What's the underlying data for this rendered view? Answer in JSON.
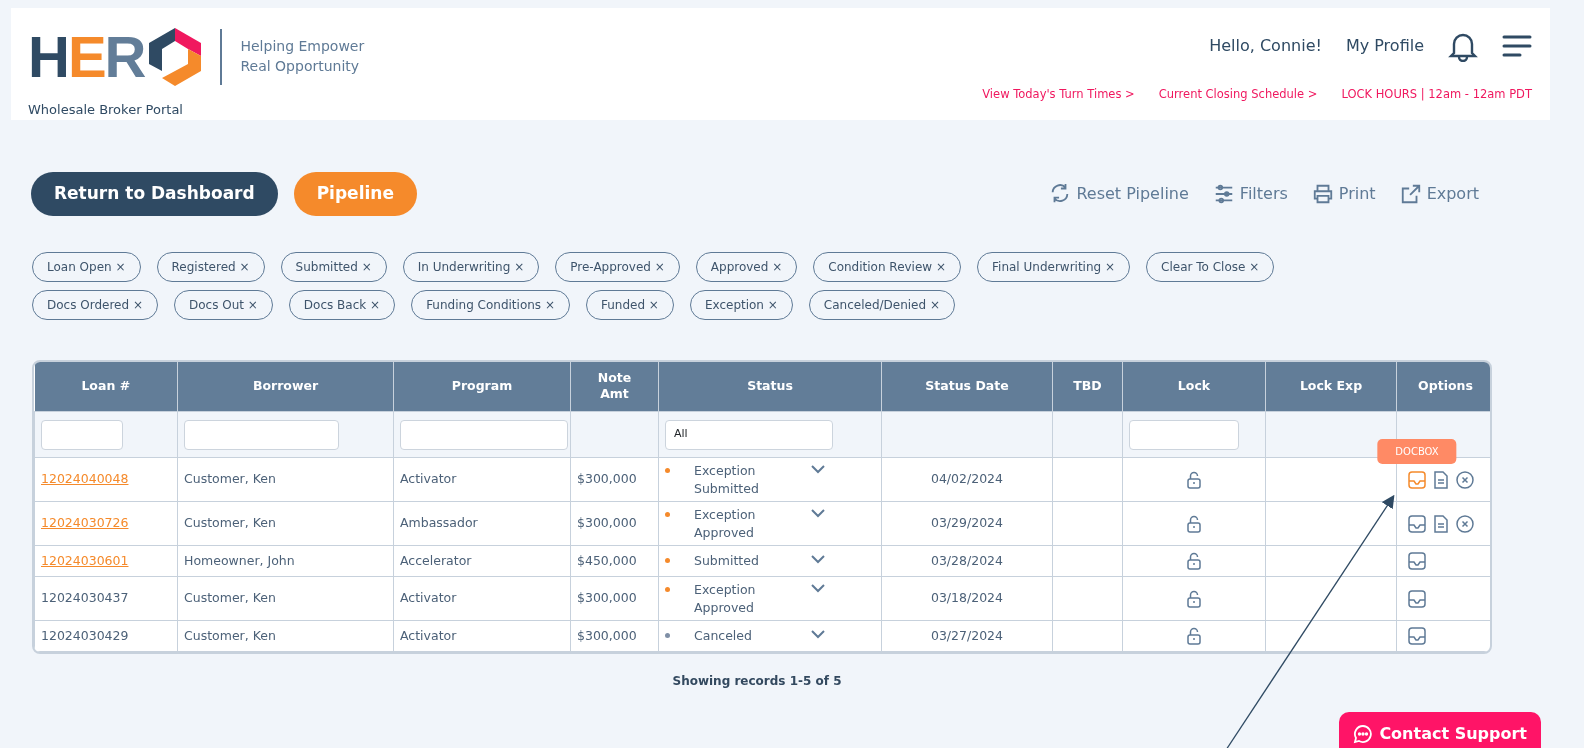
{
  "header": {
    "logo": {
      "letters": [
        "H",
        "E",
        "R"
      ]
    },
    "tagline": [
      "Helping Empower",
      "Real Opportunity"
    ],
    "portal_name": "Wholesale Broker Portal",
    "greeting": "Hello, Connie!",
    "profile_link": "My Profile",
    "links": [
      "View Today's Turn Times >",
      "Current Closing Schedule >",
      "LOCK HOURS | 12am - 12am PDT"
    ]
  },
  "actions": {
    "primary": [
      {
        "label": "Return to Dashboard",
        "kind": "dark"
      },
      {
        "label": "Pipeline",
        "kind": "orange"
      }
    ],
    "tools": [
      {
        "label": "Reset Pipeline",
        "kind": "reset"
      },
      {
        "label": "Filters",
        "kind": "filters"
      },
      {
        "label": "Print",
        "kind": "print"
      },
      {
        "label": "Export",
        "kind": "export"
      }
    ]
  },
  "filter_chips": [
    [
      {
        "label": "Loan Open",
        "remove": "×"
      },
      {
        "label": "Registered",
        "remove": "×"
      },
      {
        "label": "Submitted",
        "remove": "×"
      },
      {
        "label": "In Underwriting",
        "remove": "×"
      },
      {
        "label": "Pre-Approved",
        "remove": "×"
      },
      {
        "label": "Approved",
        "remove": "×"
      },
      {
        "label": "Condition Review",
        "remove": "×"
      },
      {
        "label": "Final Underwriting",
        "remove": "×"
      },
      {
        "label": "Clear To Close",
        "remove": "×"
      }
    ],
    [
      {
        "label": "Docs Ordered",
        "remove": "×"
      },
      {
        "label": "Docs Out",
        "remove": "×"
      },
      {
        "label": "Docs Back",
        "remove": "×"
      },
      {
        "label": "Funding Conditions",
        "remove": "×"
      },
      {
        "label": "Funded",
        "remove": "×"
      },
      {
        "label": "Exception",
        "remove": "×"
      },
      {
        "label": "Canceled/Denied",
        "remove": "×"
      }
    ]
  ],
  "table": {
    "columns": [
      {
        "label": "Loan #",
        "kind": "text"
      },
      {
        "label": "Borrower",
        "kind": "text"
      },
      {
        "label": "Program",
        "kind": "select"
      },
      {
        "label": "Note Amt",
        "kind": "none"
      },
      {
        "label": "Status",
        "kind": "select",
        "value": "All"
      },
      {
        "label": "Status Date",
        "kind": "none"
      },
      {
        "label": "TBD",
        "kind": "none"
      },
      {
        "label": "Lock",
        "kind": "select"
      },
      {
        "label": "Lock Exp",
        "kind": "none"
      },
      {
        "label": "Options",
        "kind": "none"
      }
    ],
    "rows": [
      {
        "loan": "12024040048",
        "linked": true,
        "borrower": "Customer, Ken",
        "program": "Activator",
        "note_amt": "$300,000",
        "status": "Exception Submitted",
        "color": "#f58a2b",
        "status_date": "04/02/2024",
        "options": [
          {
            "kind": "docbox",
            "highlighted": true,
            "tooltip": "DOCBOX"
          },
          {
            "kind": "document",
            "highlighted": false
          },
          {
            "kind": "cancel",
            "highlighted": false
          }
        ]
      },
      {
        "loan": "12024030726",
        "linked": true,
        "borrower": "Customer, Ken",
        "program": "Ambassador",
        "note_amt": "$300,000",
        "status": "Exception Approved",
        "color": "#f58a2b",
        "status_date": "03/29/2024",
        "options": [
          {
            "kind": "docbox",
            "highlighted": false
          },
          {
            "kind": "document",
            "highlighted": false
          },
          {
            "kind": "cancel",
            "highlighted": false
          }
        ]
      },
      {
        "loan": "12024030601",
        "linked": true,
        "borrower": "Homeowner, John",
        "program": "Accelerator",
        "note_amt": "$450,000",
        "status": "Submitted",
        "color": "#f58a2b",
        "status_date": "03/28/2024",
        "options": [
          {
            "kind": "docbox",
            "highlighted": false
          }
        ]
      },
      {
        "loan": "12024030437",
        "linked": false,
        "borrower": "Customer, Ken",
        "program": "Activator",
        "note_amt": "$300,000",
        "status": "Exception Approved",
        "status_date": "03/18/2024",
        "color": "#f58a2b",
        "options": [
          {
            "kind": "docbox",
            "highlighted": false
          }
        ]
      },
      {
        "loan": "12024030429",
        "linked": false,
        "borrower": "Customer, Ken",
        "program": "Activator",
        "note_amt": "$300,000",
        "status": "Canceled",
        "color": "#7f8fa6",
        "status_date": "03/27/2024",
        "options": [
          {
            "kind": "docbox",
            "highlighted": false
          }
        ]
      }
    ]
  },
  "records_info": "Showing records 1-5 of 5",
  "contact_button": "Contact Support"
}
